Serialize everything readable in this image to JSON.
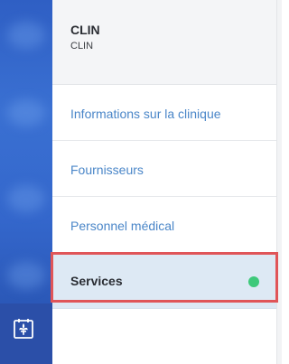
{
  "clinic": {
    "name": "CLIN",
    "code": "CLIN"
  },
  "nav": {
    "items": [
      {
        "label": "Informations sur la clinique"
      },
      {
        "label": "Fournisseurs"
      },
      {
        "label": "Personnel médical"
      },
      {
        "label": "Services"
      }
    ],
    "active_index": 3,
    "status_color": "#3ec97a"
  },
  "colors": {
    "link": "#4a86c8",
    "active_bg": "#dde9f4",
    "highlight": "#e05558",
    "rail": "#3467cc"
  },
  "icons": {
    "rail_bottom": "fleur-de-lis-calendar-icon"
  }
}
